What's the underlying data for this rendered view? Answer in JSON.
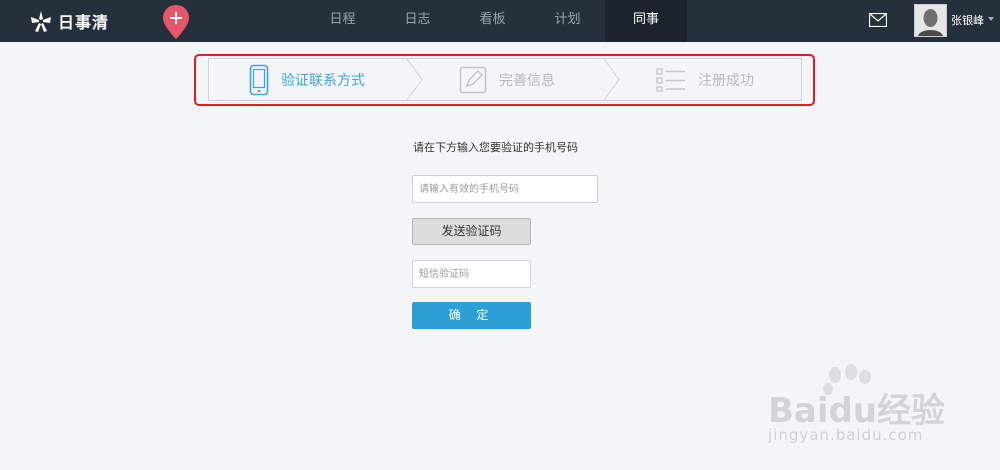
{
  "header": {
    "app_name": "日事清",
    "nav": [
      "日程",
      "日志",
      "看板",
      "计划",
      "同事"
    ],
    "active_nav": "同事",
    "user_name": "张银峰"
  },
  "steps": [
    {
      "label": "验证联系方式",
      "icon": "phone-icon",
      "active": true
    },
    {
      "label": "完善信息",
      "icon": "edit-icon",
      "active": false
    },
    {
      "label": "注册成功",
      "icon": "list-icon",
      "active": false
    }
  ],
  "form": {
    "prompt": "请在下方输入您要验证的手机号码",
    "phone_placeholder": "请输入有效的手机号码",
    "send_code_label": "发送验证码",
    "code_placeholder": "短信验证码",
    "confirm_label": "确 定"
  },
  "watermark": {
    "brand": "Baidu经验",
    "url": "jingyan.baidu.com"
  },
  "colors": {
    "topbar": "#26303d",
    "accent": "#2d9ed6",
    "highlight": "#e21b23"
  }
}
